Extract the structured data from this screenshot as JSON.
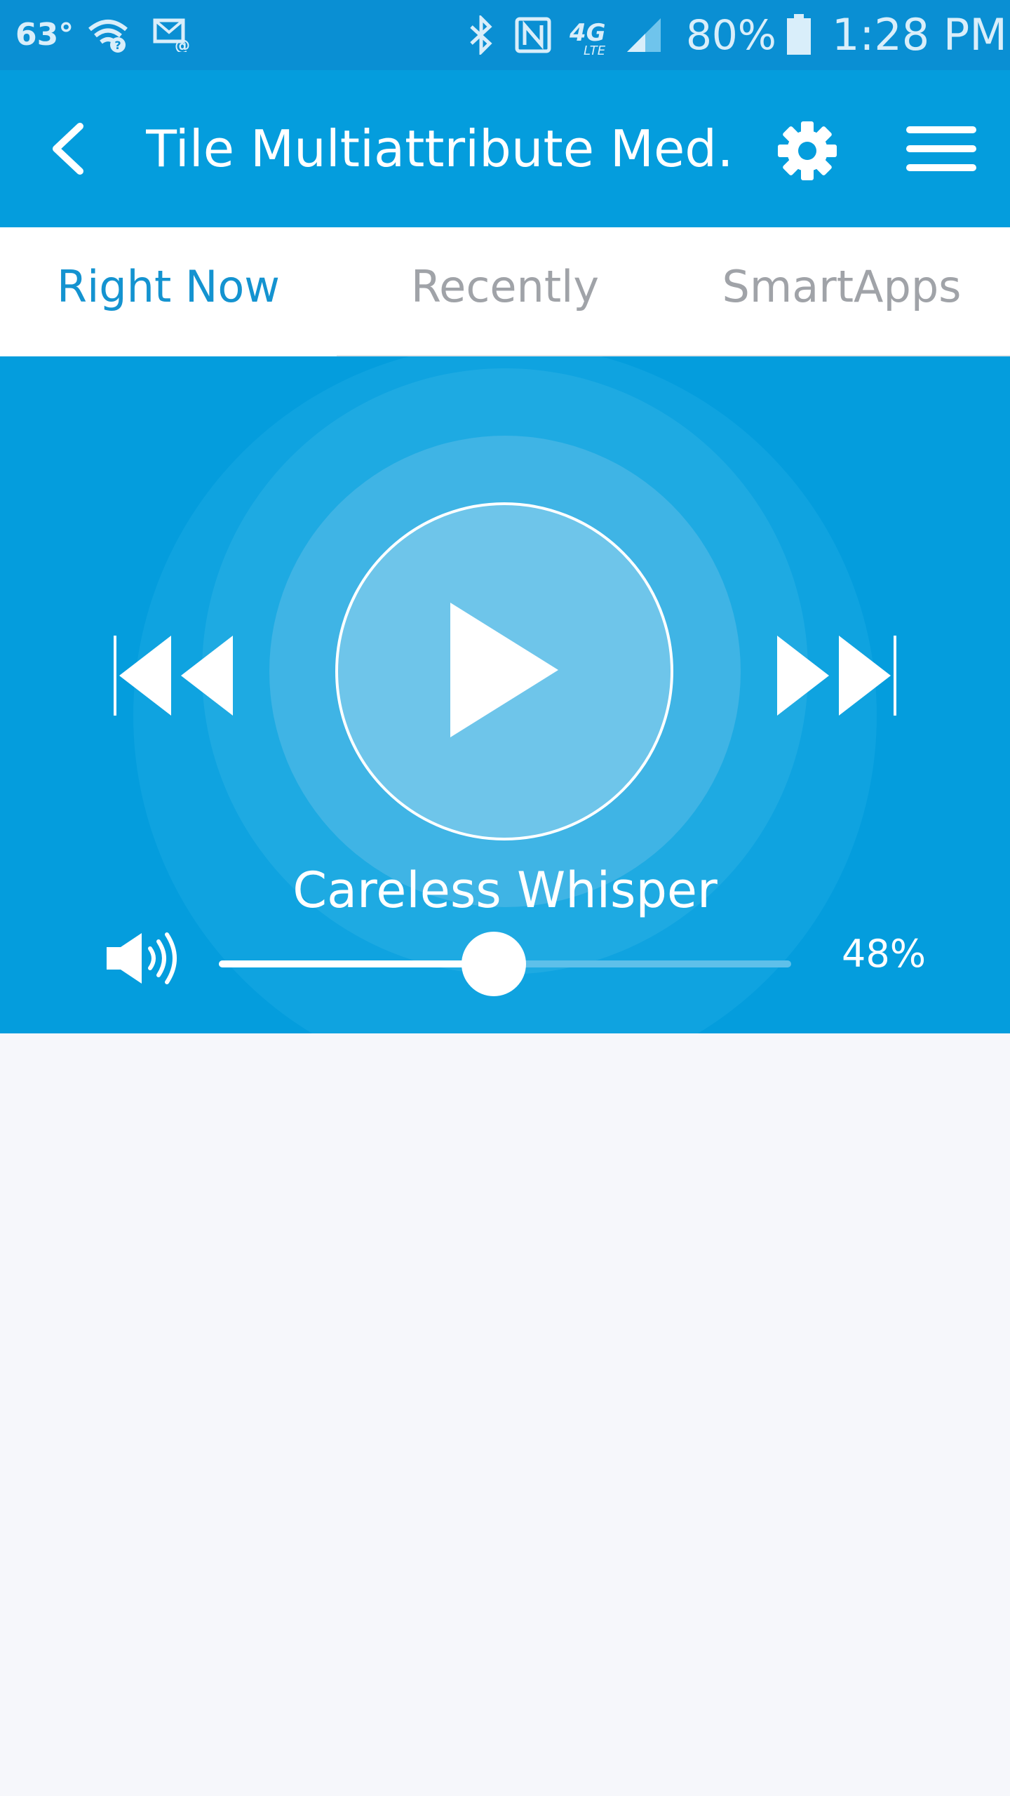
{
  "status_bar": {
    "temperature": "63°",
    "battery": "80%",
    "time": "1:28 PM",
    "icons": [
      "wifi-question-icon",
      "email-notification-icon",
      "bluetooth-icon",
      "nfc-icon",
      "4g-lte-icon",
      "signal-icon",
      "battery-icon"
    ]
  },
  "app_bar": {
    "title": "Tile Multiattribute Med…",
    "back_icon": "chevron-left-icon",
    "settings_icon": "gear-icon",
    "menu_icon": "hamburger-menu-icon"
  },
  "tabs": [
    {
      "label": "Right Now",
      "active": true
    },
    {
      "label": "Recently",
      "active": false
    },
    {
      "label": "SmartApps",
      "active": false
    }
  ],
  "player": {
    "track": "Careless Whisper",
    "volume_level": 0.48,
    "volume_text": "48%",
    "state": "paused",
    "controls": [
      "previous-track",
      "play",
      "next-track"
    ]
  },
  "colors": {
    "status_bar": "#0a8fd3",
    "accent": "#049ddd",
    "active_tab": "#1493d0",
    "inactive_tab": "#a0a3a8",
    "background": "#f6f7fb"
  }
}
